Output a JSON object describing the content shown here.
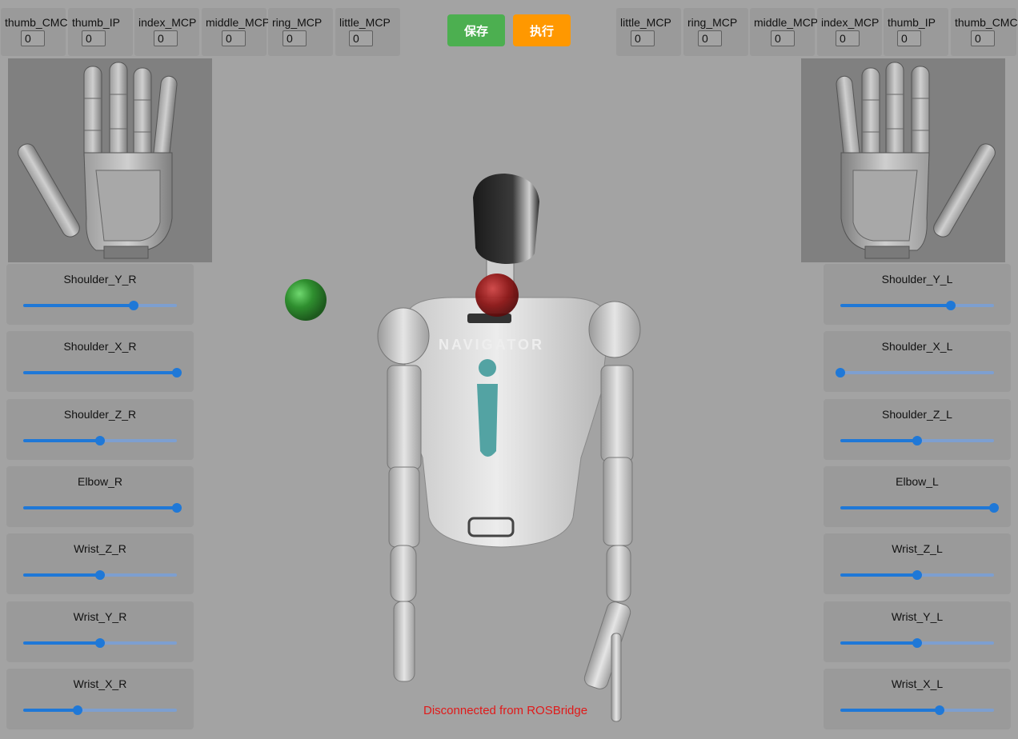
{
  "right_hand_fingers": [
    {
      "label": "thumb_CMC",
      "value": "0"
    },
    {
      "label": "thumb_IP",
      "value": "0"
    },
    {
      "label": "index_MCP",
      "value": "0"
    },
    {
      "label": "middle_MCP",
      "value": "0"
    },
    {
      "label": "ring_MCP",
      "value": "0"
    },
    {
      "label": "little_MCP",
      "value": "0"
    }
  ],
  "left_hand_fingers": [
    {
      "label": "little_MCP",
      "value": "0"
    },
    {
      "label": "ring_MCP",
      "value": "0"
    },
    {
      "label": "middle_MCP",
      "value": "0"
    },
    {
      "label": "index_MCP",
      "value": "0"
    },
    {
      "label": "thumb_IP",
      "value": "0"
    },
    {
      "label": "thumb_CMC",
      "value": "0"
    }
  ],
  "buttons": {
    "save": "保存",
    "execute": "执行"
  },
  "colors": {
    "save": "#4caf50",
    "execute": "#ff9800",
    "slider": "#1f78d7",
    "status_error": "#e01a1a"
  },
  "right_arm_sliders": [
    {
      "label": "Shoulder_Y_R",
      "level": 0.72
    },
    {
      "label": "Shoulder_X_R",
      "level": 1.0
    },
    {
      "label": "Shoulder_Z_R",
      "level": 0.5
    },
    {
      "label": "Elbow_R",
      "level": 1.0
    },
    {
      "label": "Wrist_Z_R",
      "level": 0.5
    },
    {
      "label": "Wrist_Y_R",
      "level": 0.5
    },
    {
      "label": "Wrist_X_R",
      "level": 0.355
    }
  ],
  "left_arm_sliders": [
    {
      "label": "Shoulder_Y_L",
      "level": 0.72
    },
    {
      "label": "Shoulder_X_L",
      "level": 0.0
    },
    {
      "label": "Shoulder_Z_L",
      "level": 0.5
    },
    {
      "label": "Elbow_L",
      "level": 1.0
    },
    {
      "label": "Wrist_Z_L",
      "level": 0.5
    },
    {
      "label": "Wrist_Y_L",
      "level": 0.5
    },
    {
      "label": "Wrist_X_L",
      "level": 0.645
    }
  ],
  "robot": {
    "chest_logo": "NAVIGATOR"
  },
  "status": "Disconnected from ROSBridge"
}
